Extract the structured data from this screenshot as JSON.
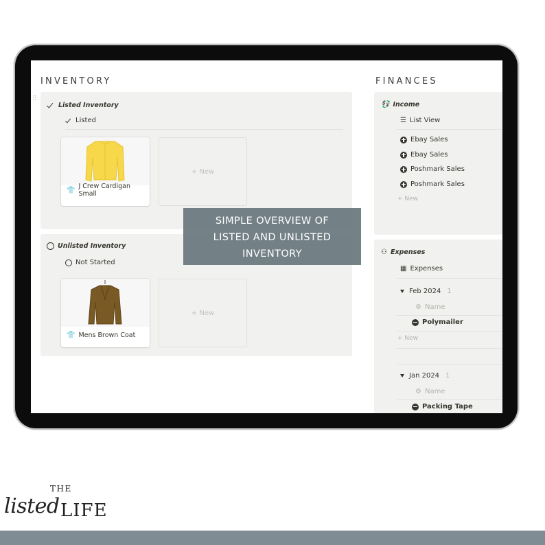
{
  "inventory": {
    "title": "INVENTORY",
    "listed": {
      "header": "Listed Inventory",
      "view_label": "Listed",
      "card_label": "J Crew Cardigan Small",
      "new_label": "+ New"
    },
    "unlisted": {
      "header": "Unlisted Inventory",
      "view_label": "Not Started",
      "card_label": "Mens Brown Coat",
      "new_label": "+ New"
    }
  },
  "finances": {
    "title": "FINANCES",
    "income": {
      "header": "Income",
      "view_label": "List View",
      "items": [
        "Ebay Sales",
        "Ebay Sales",
        "Poshmark Sales",
        "Poshmark Sales"
      ],
      "new_label": "+ New"
    },
    "expenses": {
      "header": "Expenses",
      "view_label": "Expenses",
      "groups": [
        {
          "label": "Feb 2024",
          "count": "1",
          "name_header": "Name",
          "item": "Polymailer",
          "new_label": "+ New"
        },
        {
          "label": "Jan 2024",
          "count": "1",
          "name_header": "Name",
          "item": "Packing Tape"
        }
      ]
    }
  },
  "overlay": {
    "line1": "SIMPLE OVERVIEW OF",
    "line2": "LISTED AND UNLISTED",
    "line3": "INVENTORY"
  },
  "brand": {
    "the": "THE",
    "listed": "listed",
    "life": "LIFE"
  },
  "colors": {
    "overlay": "#68777d",
    "bottom_bar": "#7f8c93",
    "panel": "#f1f1ef",
    "cardigan": "#f6d84a",
    "coat": "#7a5a24"
  }
}
